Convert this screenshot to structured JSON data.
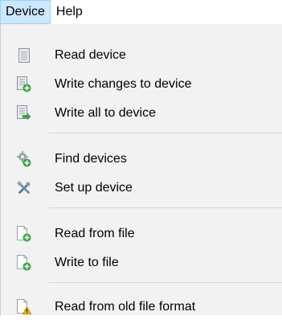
{
  "menubar": {
    "items": [
      {
        "label": "Device",
        "active": true
      },
      {
        "label": "Help",
        "active": false
      }
    ]
  },
  "menu": {
    "items": [
      {
        "label": "Read device",
        "icon": "document-icon"
      },
      {
        "label": "Write changes to device",
        "icon": "document-add-icon"
      },
      {
        "label": "Write all to device",
        "icon": "document-arrow-icon"
      },
      {
        "label": "Find devices",
        "icon": "gear-search-icon"
      },
      {
        "label": "Set up device",
        "icon": "tools-icon"
      },
      {
        "label": "Read from file",
        "icon": "file-add-icon"
      },
      {
        "label": "Write to file",
        "icon": "file-add-icon"
      },
      {
        "label": "Read from old file format",
        "icon": "file-warning-icon"
      }
    ]
  },
  "colors": {
    "menubar_highlight": "#cce8ff",
    "menubar_highlight_border": "#99d1ff",
    "menu_background": "#f2f2f2",
    "separator": "#d7d7d7",
    "icon_green": "#3aa53a",
    "icon_warning": "#f2b400"
  }
}
